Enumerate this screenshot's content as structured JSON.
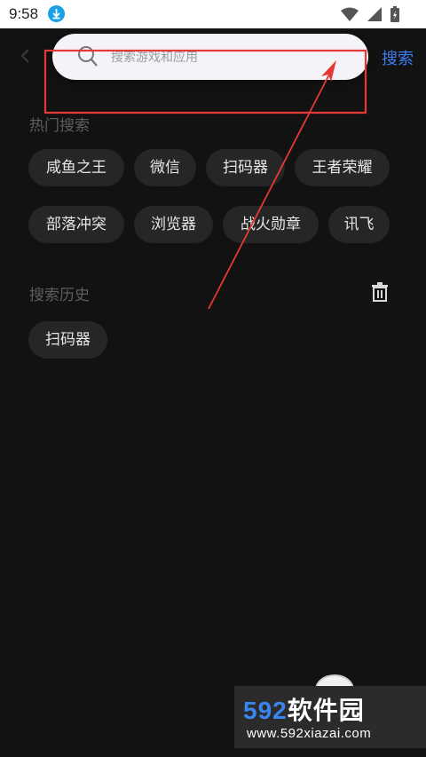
{
  "status_bar": {
    "time": "9:58"
  },
  "search": {
    "placeholder": "搜索游戏和应用",
    "button_label": "搜索"
  },
  "hot_search": {
    "title": "热门搜索",
    "tags": [
      "咸鱼之王",
      "微信",
      "扫码器",
      "王者荣耀",
      "部落冲突",
      "浏览器",
      "战火勋章",
      "讯飞"
    ]
  },
  "history": {
    "title": "搜索历史",
    "items": [
      "扫码器"
    ]
  },
  "watermark": {
    "logo_number": "592",
    "logo_text": "软件园",
    "url": "www.592xiazai.com"
  },
  "colors": {
    "accent": "#3d7ef5",
    "annotation": "#e53935",
    "background": "#121212"
  }
}
